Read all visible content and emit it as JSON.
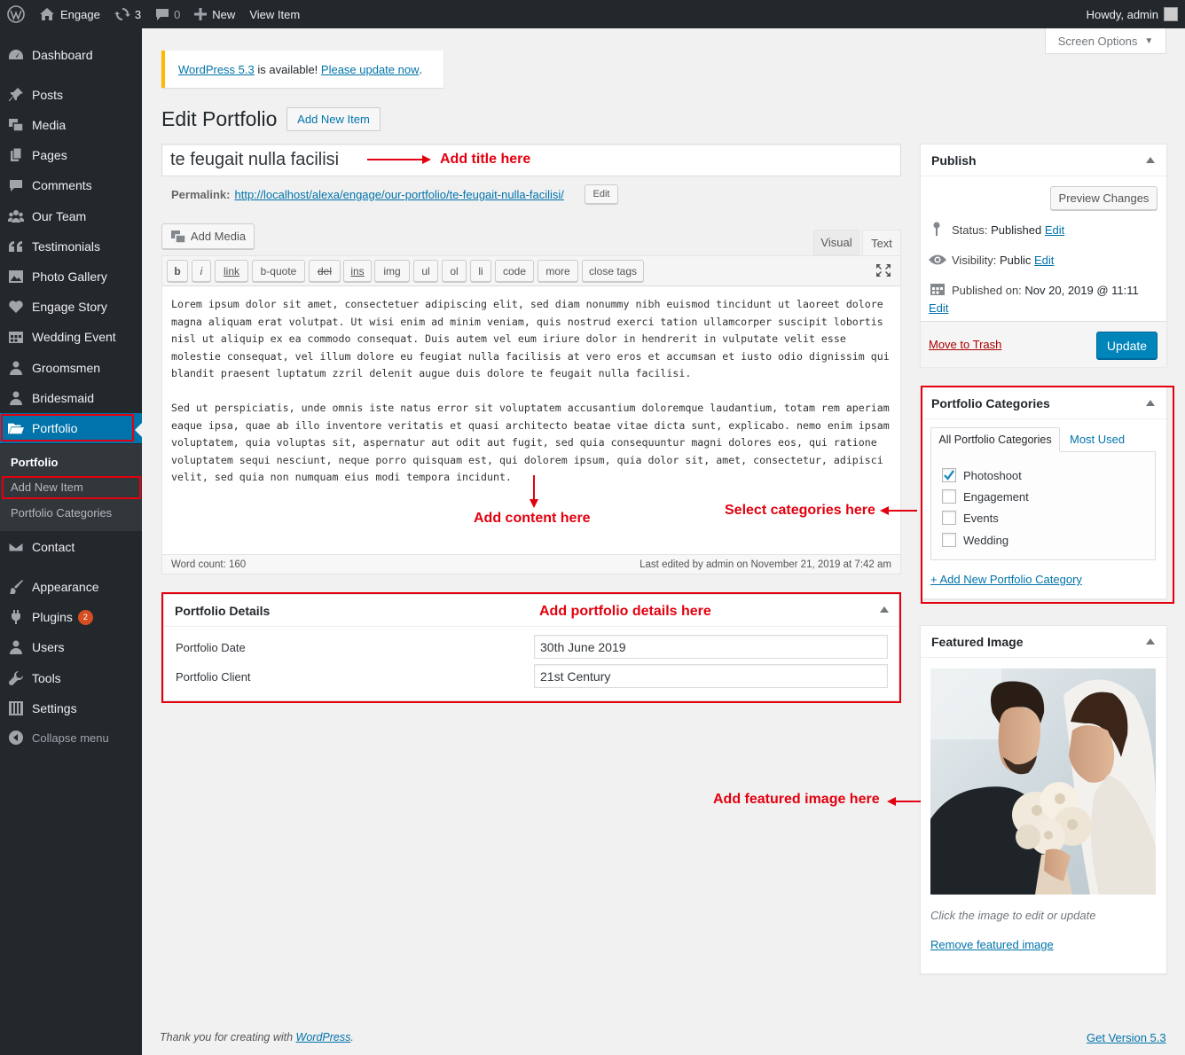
{
  "adminbar": {
    "site": "Engage",
    "updates": "3",
    "comments": "0",
    "new": "New",
    "view": "View Item",
    "howdy": "Howdy, admin"
  },
  "sidebar": {
    "items": [
      "Dashboard",
      "Posts",
      "Media",
      "Pages",
      "Comments",
      "Our Team",
      "Testimonials",
      "Photo Gallery",
      "Engage Story",
      "Wedding Event",
      "Groomsmen",
      "Bridesmaid",
      "Portfolio",
      "Contact",
      "Appearance",
      "Plugins",
      "Users",
      "Tools",
      "Settings",
      "Collapse menu"
    ],
    "plugins_badge": "2",
    "submenu": [
      "Portfolio",
      "Add New Item",
      "Portfolio Categories"
    ]
  },
  "screen_options": "Screen Options",
  "notice": {
    "version_link": "WordPress 5.3",
    "middle": " is available! ",
    "update_link": "Please update now",
    "end": "."
  },
  "page": {
    "title": "Edit Portfolio",
    "add_new": "Add New Item"
  },
  "post_title": "te feugait nulla facilisi",
  "permalink": {
    "label": "Permalink:",
    "url": "http://localhost/alexa/engage/our-portfolio/te-feugait-nulla-facilisi/",
    "edit": "Edit"
  },
  "editor": {
    "add_media": "Add Media",
    "tab_visual": "Visual",
    "tab_text": "Text",
    "quicktags": [
      "b",
      "i",
      "link",
      "b-quote",
      "del",
      "ins",
      "img",
      "ul",
      "ol",
      "li",
      "code",
      "more",
      "close tags"
    ],
    "para1": "Lorem ipsum dolor sit amet, consectetuer adipiscing elit, sed diam nonummy nibh euismod tincidunt ut laoreet dolore magna aliquam erat volutpat. Ut wisi enim ad minim veniam, quis nostrud exerci tation ullamcorper suscipit lobortis nisl ut aliquip ex ea commodo consequat. Duis autem vel eum iriure dolor in hendrerit in vulputate velit esse molestie consequat, vel illum dolore eu feugiat nulla facilisis at vero eros et accumsan et iusto odio dignissim qui blandit praesent luptatum zzril delenit augue duis dolore te feugait nulla facilisi.",
    "para2": "Sed ut perspiciatis, unde omnis iste natus error sit voluptatem accusantium doloremque laudantium, totam rem aperiam eaque ipsa, quae ab illo inventore veritatis et quasi architecto beatae vitae dicta sunt, explicabo. nemo enim ipsam voluptatem, quia voluptas sit, aspernatur aut odit aut fugit, sed quia consequuntur magni dolores eos, qui ratione voluptatem sequi nesciunt, neque porro quisquam est, qui dolorem ipsum, quia dolor sit, amet, consectetur, adipisci velit, sed quia non numquam eius modi tempora incidunt.",
    "word_count": "Word count: 160",
    "last_edited": "Last edited by admin on November 21, 2019 at 7:42 am"
  },
  "details": {
    "title": "Portfolio Details",
    "date_label": "Portfolio Date",
    "date_value": "30th June 2019",
    "client_label": "Portfolio Client",
    "client_value": "21st Century"
  },
  "publish": {
    "title": "Publish",
    "preview": "Preview Changes",
    "status_label": "Status: ",
    "status_value": "Published",
    "visibility_label": "Visibility: ",
    "visibility_value": "Public",
    "published_label": "Published on: ",
    "published_value": "Nov 20, 2019 @ 11:11",
    "edit": "Edit",
    "trash": "Move to Trash",
    "update": "Update"
  },
  "categories": {
    "title": "Portfolio Categories",
    "tab_all": "All Portfolio Categories",
    "tab_most": "Most Used",
    "items": [
      {
        "label": "Photoshoot",
        "checked": true
      },
      {
        "label": "Engagement",
        "checked": false
      },
      {
        "label": "Events",
        "checked": false
      },
      {
        "label": "Wedding",
        "checked": false
      }
    ],
    "add_new": "+ Add New Portfolio Category"
  },
  "featured": {
    "title": "Featured Image",
    "hint": "Click the image to edit or update",
    "remove": "Remove featured image"
  },
  "annotations": {
    "title": "Add title here",
    "content": "Add content here",
    "categories": "Select categories here",
    "details": "Add portfolio details here",
    "featured": "Add featured image here"
  },
  "footer": {
    "thanks": "Thank you for creating with ",
    "wp": "WordPress",
    "dot": ".",
    "version": "Get Version 5.3"
  },
  "colors": {
    "accent": "#0073aa",
    "annotation": "#e3000f",
    "sidebar": "#23282d"
  }
}
